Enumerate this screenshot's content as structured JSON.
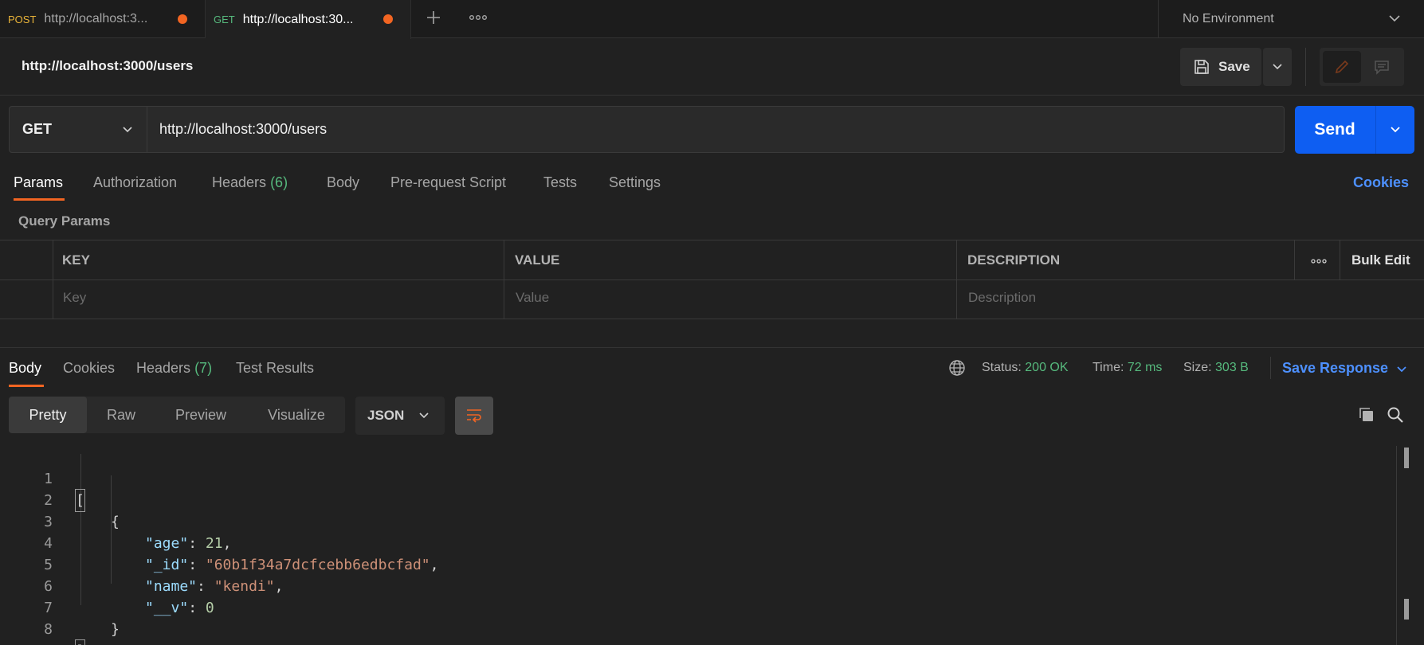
{
  "tabs": [
    {
      "method": "POST",
      "title": "http://localhost:3...",
      "unsaved": true
    },
    {
      "method": "GET",
      "title": "http://localhost:30...",
      "unsaved": true
    }
  ],
  "environment": {
    "selected": "No Environment"
  },
  "request": {
    "title": "http://localhost:3000/users",
    "method": "GET",
    "url": "http://localhost:3000/users"
  },
  "header_actions": {
    "save_label": "Save"
  },
  "send": {
    "label": "Send"
  },
  "request_tabs": {
    "params": "Params",
    "authorization": "Authorization",
    "headers": "Headers",
    "headers_count": "(6)",
    "body": "Body",
    "pre_request": "Pre-request Script",
    "tests": "Tests",
    "settings": "Settings",
    "cookies": "Cookies"
  },
  "query_params": {
    "label": "Query Params",
    "columns": {
      "key": "KEY",
      "value": "VALUE",
      "description": "DESCRIPTION"
    },
    "bulk_edit": "Bulk Edit",
    "placeholders": {
      "key": "Key",
      "value": "Value",
      "description": "Description"
    }
  },
  "response": {
    "tabs": {
      "body": "Body",
      "cookies": "Cookies",
      "headers": "Headers",
      "headers_count": "(7)",
      "test_results": "Test Results"
    },
    "status_label": "Status:",
    "status_value": "200 OK",
    "time_label": "Time:",
    "time_value": "72 ms",
    "size_label": "Size:",
    "size_value": "303 B",
    "save_response": "Save Response",
    "formats": {
      "pretty": "Pretty",
      "raw": "Raw",
      "preview": "Preview",
      "visualize": "Visualize"
    },
    "language": "JSON",
    "lines": [
      {
        "n": "1",
        "text": "["
      },
      {
        "n": "2",
        "text": "{"
      },
      {
        "n": "3",
        "key": "\"age\"",
        "value": "21",
        "vtype": "num",
        "trail": ","
      },
      {
        "n": "4",
        "key": "\"_id\"",
        "value": "\"60b1f34a7dcfcebb6edbcfad\"",
        "vtype": "str",
        "trail": ","
      },
      {
        "n": "5",
        "key": "\"name\"",
        "value": "\"kendi\"",
        "vtype": "str",
        "trail": ","
      },
      {
        "n": "6",
        "key": "\"__v\"",
        "value": "0",
        "vtype": "num",
        "trail": ""
      },
      {
        "n": "7",
        "text": "}"
      },
      {
        "n": "8",
        "text": "]"
      }
    ]
  },
  "colors": {
    "accent_orange": "#f26522",
    "send_blue": "#0e5ef2",
    "link_blue": "#4d90fe",
    "success_green": "#56b97d",
    "post_method": "#e8b339",
    "json_key": "#9cdcfe",
    "json_string": "#ce9178",
    "json_number": "#b5cea8"
  },
  "icons": [
    "plus-icon",
    "more-icon",
    "chevron-down-icon",
    "save-icon",
    "pencil-icon",
    "comment-icon",
    "globe-icon",
    "wrap-icon",
    "copy-icon",
    "search-icon"
  ]
}
